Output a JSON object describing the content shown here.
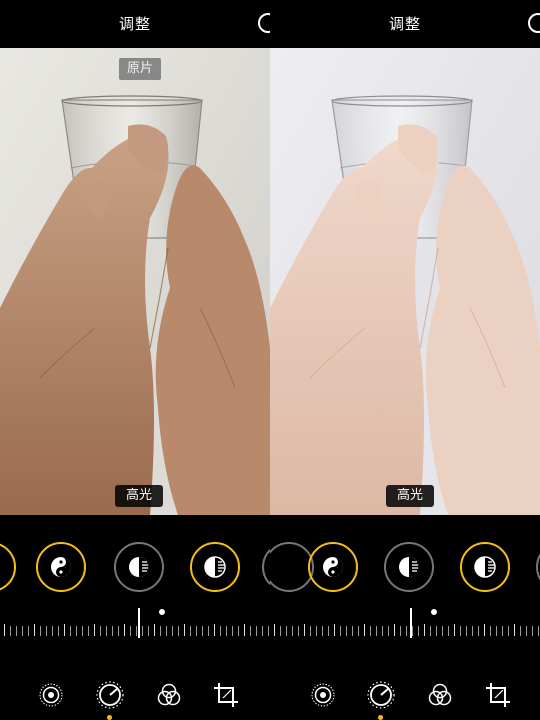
{
  "panels": [
    {
      "title": "调整",
      "badge": "原片",
      "adjustment_label": "高光",
      "tabs": [
        "auto-enhance-icon",
        "adjust-dial-icon",
        "filters-icon",
        "crop-icon"
      ],
      "active_tab": "adjust-dial-icon"
    },
    {
      "title": "调整",
      "adjustment_label": "高光",
      "tabs": [
        "auto-enhance-icon",
        "adjust-dial-icon",
        "filters-icon",
        "crop-icon"
      ],
      "active_tab": "adjust-dial-icon"
    }
  ],
  "colors": {
    "accent": "#f5c016",
    "background": "#000000"
  }
}
